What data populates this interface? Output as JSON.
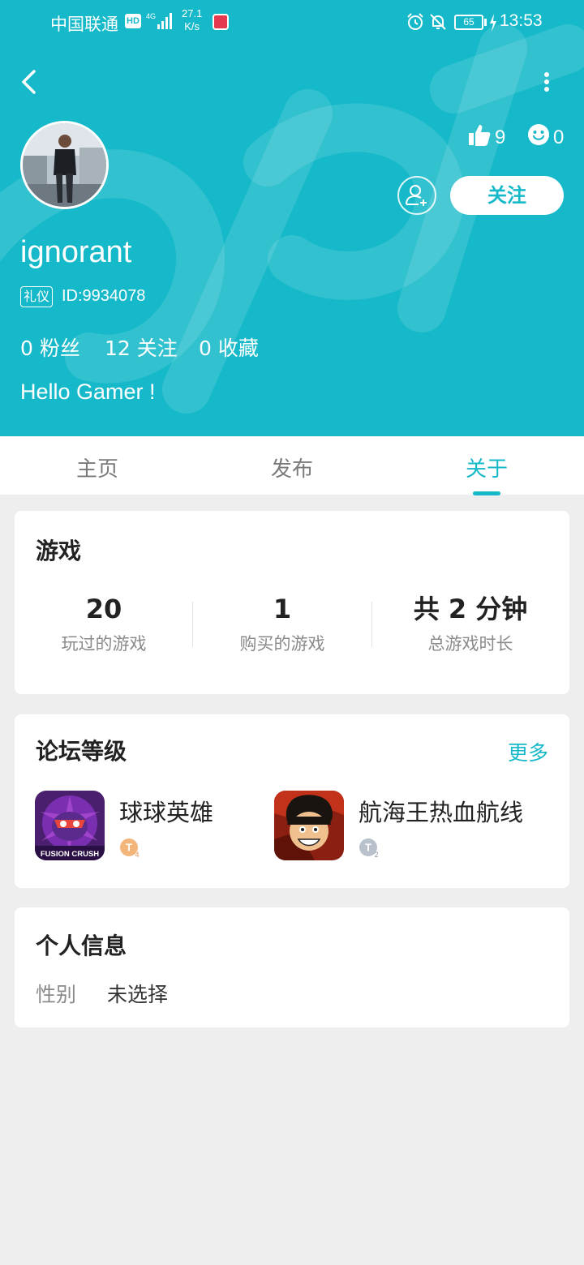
{
  "status_bar": {
    "carrier": "中国联通",
    "network_badge": "HD",
    "net_speed_value": "27.1",
    "net_speed_unit": "K/s",
    "battery": "65",
    "time": "13:53"
  },
  "header": {
    "likes_count": "9",
    "smiles_count": "0",
    "follow_label": "关注",
    "username": "ignorant",
    "badge": "礼仪",
    "user_id": "ID:9934078",
    "stats": [
      {
        "count": "0",
        "label": "粉丝"
      },
      {
        "count": "12",
        "label": "关注"
      },
      {
        "count": "0",
        "label": "收藏"
      }
    ],
    "bio": "Hello Gamer !"
  },
  "tabs": [
    {
      "label": "主页",
      "active": false
    },
    {
      "label": "发布",
      "active": false
    },
    {
      "label": "关于",
      "active": true
    }
  ],
  "games_card": {
    "title": "游戏",
    "stats": [
      {
        "value": "20",
        "label": "玩过的游戏"
      },
      {
        "value": "1",
        "label": "购买的游戏"
      },
      {
        "value": "共 2 分钟",
        "label": "总游戏时长"
      }
    ]
  },
  "forum_card": {
    "title": "论坛等级",
    "more_label": "更多",
    "items": [
      {
        "name": "球球英雄",
        "icon_text": "FUSION CRUSH",
        "level": "4",
        "level_color": "#f3b67a"
      },
      {
        "name": "航海王热血航线",
        "level": "2",
        "level_color": "#b9c2cc"
      }
    ]
  },
  "info_card": {
    "title": "个人信息",
    "gender_label": "性别",
    "gender_value": "未选择"
  },
  "colors": {
    "accent": "#16b9c9",
    "background": "#eeeeee"
  }
}
